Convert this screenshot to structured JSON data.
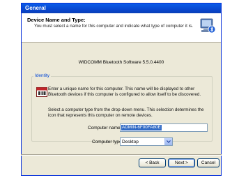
{
  "window": {
    "title": "General"
  },
  "header": {
    "title": "Device Name and Type:",
    "subtitle": "You must select a name for this computer and indicate what type of computer it is.",
    "icon": "computer-bluetooth-icon"
  },
  "version_text": "WIDCOMM Bluetooth Software 5.5.0.4400",
  "identity": {
    "group_label": "Identity",
    "icon": "id-card-icon",
    "paragraph1": "Enter a unique name for this computer.  This name will be displayed to other Bluetooth devices if this computer is configured to allow itself to be discovered.",
    "paragraph2": "Select a computer type from the drop-down menu.  This selection determines the icon that represents this computer on remote devices.",
    "computer_name_label": "Computer name:",
    "computer_name_value": "ADMIN-6F00FA80E",
    "computer_type_label": "Computer type:",
    "computer_type_value": "Desktop"
  },
  "buttons": {
    "back": "< Back",
    "next": "Next >",
    "cancel": "Cancel"
  },
  "colors": {
    "title_bar": "#0a5de8",
    "selection": "#316ac5",
    "group_label": "#0046d5"
  }
}
